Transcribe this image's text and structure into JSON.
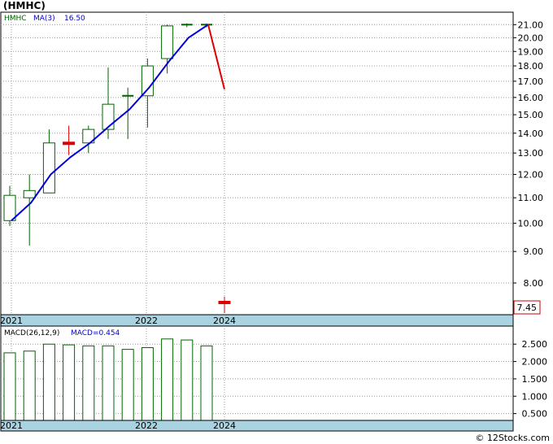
{
  "title": "(HMHC)",
  "footer": "© 12Stocks.com",
  "chart_data": {
    "type": "candlestick",
    "price_panel": {
      "legend": {
        "ticker": "HMHC",
        "ma_label": "MA(3)",
        "ma_value": "16.50"
      },
      "yscale": "log",
      "ylim": [
        7.15,
        21.8
      ],
      "yticks": [
        8,
        9,
        10,
        11,
        12,
        13,
        14,
        15,
        16,
        17,
        18,
        19,
        20,
        21
      ],
      "ytick_labels": [
        "8.00",
        "9.00",
        "10.00",
        "11.00",
        "12.00",
        "13.00",
        "14.00",
        "15.00",
        "16.00",
        "17.00",
        "18.00",
        "19.00",
        "20.00",
        "21.00"
      ],
      "last_price_label": "7.45",
      "xlabels": [
        "2021",
        "2022",
        "2024"
      ],
      "candles": [
        {
          "o": 10.1,
          "h": 11.5,
          "l": 9.9,
          "c": 11.1,
          "color": "green"
        },
        {
          "o": 11.0,
          "h": 12.0,
          "l": 9.2,
          "c": 11.3,
          "color": "green"
        },
        {
          "o": 11.2,
          "h": 14.2,
          "l": 11.2,
          "c": 13.5,
          "color": "green"
        },
        {
          "o": 13.5,
          "h": 14.4,
          "l": 12.9,
          "c": 13.5,
          "color": "red"
        },
        {
          "o": 13.5,
          "h": 14.4,
          "l": 13.0,
          "c": 14.2,
          "color": "green"
        },
        {
          "o": 14.2,
          "h": 17.9,
          "l": 13.7,
          "c": 15.6,
          "color": "green"
        },
        {
          "o": 16.1,
          "h": 16.6,
          "l": 13.7,
          "c": 16.1,
          "color": "green"
        },
        {
          "o": 16.1,
          "h": 18.5,
          "l": 14.3,
          "c": 18.0,
          "color": "green"
        },
        {
          "o": 18.5,
          "h": 21.0,
          "l": 17.5,
          "c": 20.9,
          "color": "green"
        },
        {
          "o": 20.9,
          "h": 21.1,
          "l": 20.8,
          "c": 21.0,
          "color": "green"
        },
        {
          "o": 21.0,
          "h": 21.1,
          "l": 20.8,
          "c": 21.0,
          "color": "green"
        },
        {
          "o": 7.45,
          "h": 7.6,
          "l": 7.15,
          "c": 7.45,
          "color": "red"
        }
      ],
      "ma": [
        10.1,
        10.8,
        12.0,
        12.8,
        13.5,
        14.4,
        15.3,
        16.6,
        18.3,
        20.0,
        21.0,
        16.5
      ]
    },
    "macd_panel": {
      "legend": {
        "label": "MACD(26,12,9)",
        "value_label": "MACD=0.454"
      },
      "ylim": [
        0.35,
        2.95
      ],
      "yticks": [
        0.5,
        1.0,
        1.5,
        2.0,
        2.5
      ],
      "ytick_labels": [
        "0.500",
        "1.000",
        "1.500",
        "2.000",
        "2.500"
      ],
      "values": [
        2.25,
        2.3,
        2.5,
        2.48,
        2.45,
        2.45,
        2.35,
        2.4,
        2.65,
        2.62,
        2.45
      ],
      "xlabels": [
        "2021",
        "2022",
        "2024"
      ]
    }
  }
}
